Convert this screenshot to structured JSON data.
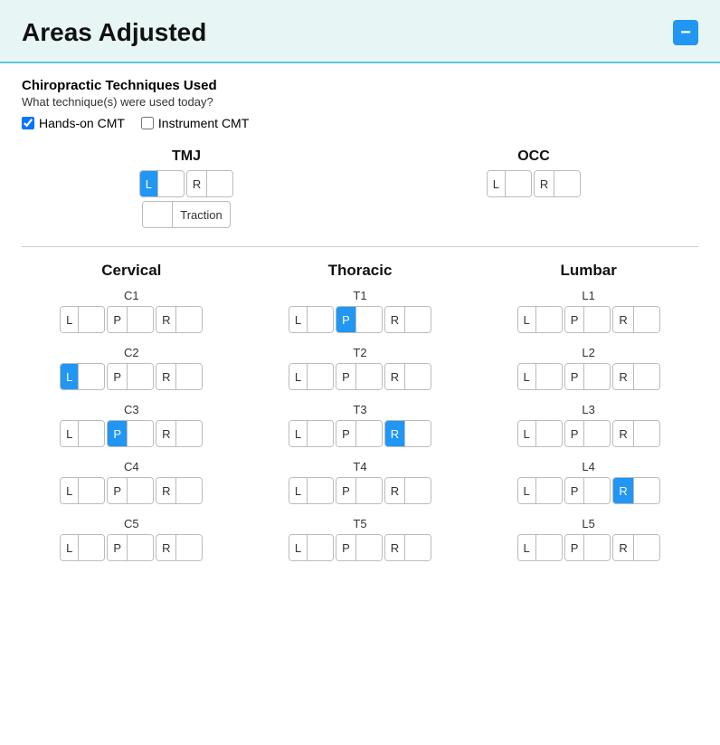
{
  "header": {
    "title": "Areas Adjusted",
    "collapse_label": "−"
  },
  "techniques": {
    "section_title": "Chiropractic Techniques Used",
    "subtitle": "What technique(s) were used today?",
    "options": [
      {
        "id": "hands_on",
        "label": "Hands-on CMT",
        "checked": true
      },
      {
        "id": "instrument",
        "label": "Instrument CMT",
        "checked": false
      }
    ]
  },
  "tmj": {
    "label": "TMJ",
    "buttons": [
      {
        "id": "tmj_l",
        "label": "L",
        "active": true
      },
      {
        "id": "tmj_r",
        "label": "R",
        "active": false
      }
    ],
    "traction_label": "Traction"
  },
  "occ": {
    "label": "OCC",
    "buttons": [
      {
        "id": "occ_l",
        "label": "L",
        "active": false
      },
      {
        "id": "occ_r",
        "label": "R",
        "active": false
      }
    ]
  },
  "cervical": {
    "label": "Cervical",
    "vertebrae": [
      {
        "name": "C1",
        "buttons": [
          {
            "label": "L",
            "active": false
          },
          {
            "label": "P",
            "active": false
          },
          {
            "label": "R",
            "active": false
          }
        ]
      },
      {
        "name": "C2",
        "buttons": [
          {
            "label": "L",
            "active": true
          },
          {
            "label": "P",
            "active": false
          },
          {
            "label": "R",
            "active": false
          }
        ]
      },
      {
        "name": "C3",
        "buttons": [
          {
            "label": "L",
            "active": false
          },
          {
            "label": "P",
            "active": true
          },
          {
            "label": "R",
            "active": false
          }
        ]
      },
      {
        "name": "C4",
        "buttons": [
          {
            "label": "L",
            "active": false
          },
          {
            "label": "P",
            "active": false
          },
          {
            "label": "R",
            "active": false
          }
        ]
      },
      {
        "name": "C5",
        "buttons": [
          {
            "label": "L",
            "active": false
          },
          {
            "label": "P",
            "active": false
          },
          {
            "label": "R",
            "active": false
          }
        ]
      }
    ]
  },
  "thoracic": {
    "label": "Thoracic",
    "vertebrae": [
      {
        "name": "T1",
        "buttons": [
          {
            "label": "L",
            "active": false
          },
          {
            "label": "P",
            "active": true
          },
          {
            "label": "R",
            "active": false
          }
        ]
      },
      {
        "name": "T2",
        "buttons": [
          {
            "label": "L",
            "active": false
          },
          {
            "label": "P",
            "active": false
          },
          {
            "label": "R",
            "active": false
          }
        ]
      },
      {
        "name": "T3",
        "buttons": [
          {
            "label": "L",
            "active": false
          },
          {
            "label": "P",
            "active": false
          },
          {
            "label": "R",
            "active": true
          }
        ]
      },
      {
        "name": "T4",
        "buttons": [
          {
            "label": "L",
            "active": false
          },
          {
            "label": "P",
            "active": false
          },
          {
            "label": "R",
            "active": false
          }
        ]
      },
      {
        "name": "T5",
        "buttons": [
          {
            "label": "L",
            "active": false
          },
          {
            "label": "P",
            "active": false
          },
          {
            "label": "R",
            "active": false
          }
        ]
      }
    ]
  },
  "lumbar": {
    "label": "Lumbar",
    "vertebrae": [
      {
        "name": "L1",
        "buttons": [
          {
            "label": "L",
            "active": false
          },
          {
            "label": "P",
            "active": false
          },
          {
            "label": "R",
            "active": false
          }
        ]
      },
      {
        "name": "L2",
        "buttons": [
          {
            "label": "L",
            "active": false
          },
          {
            "label": "P",
            "active": false
          },
          {
            "label": "R",
            "active": false
          }
        ]
      },
      {
        "name": "L3",
        "buttons": [
          {
            "label": "L",
            "active": false
          },
          {
            "label": "P",
            "active": false
          },
          {
            "label": "R",
            "active": false
          }
        ]
      },
      {
        "name": "L4",
        "buttons": [
          {
            "label": "L",
            "active": false
          },
          {
            "label": "P",
            "active": false
          },
          {
            "label": "R",
            "active": true
          }
        ]
      },
      {
        "name": "L5",
        "buttons": [
          {
            "label": "L",
            "active": false
          },
          {
            "label": "P",
            "active": false
          },
          {
            "label": "R",
            "active": false
          }
        ]
      }
    ]
  }
}
